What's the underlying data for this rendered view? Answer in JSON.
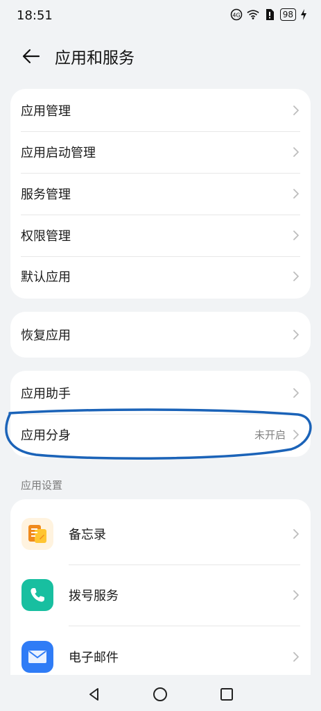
{
  "status_bar": {
    "time": "18:51",
    "battery": "98",
    "icons": [
      "volte-icon",
      "wifi-icon",
      "sim-icon",
      "battery-icon",
      "charging-icon"
    ]
  },
  "header": {
    "title": "应用和服务"
  },
  "group1": {
    "items": [
      {
        "label": "应用管理"
      },
      {
        "label": "应用启动管理"
      },
      {
        "label": "服务管理"
      },
      {
        "label": "权限管理"
      },
      {
        "label": "默认应用"
      }
    ]
  },
  "group2": {
    "items": [
      {
        "label": "恢复应用"
      }
    ]
  },
  "group3": {
    "items": [
      {
        "label": "应用助手",
        "value": ""
      },
      {
        "label": "应用分身",
        "value": "未开启"
      }
    ]
  },
  "app_settings": {
    "section_label": "应用设置",
    "items": [
      {
        "label": "备忘录",
        "icon": "memo-icon",
        "color": "#f5a623"
      },
      {
        "label": "拨号服务",
        "icon": "phone-icon",
        "color": "#1fc3a3"
      },
      {
        "label": "电子邮件",
        "icon": "email-icon",
        "color": "#2f7cf6"
      }
    ]
  },
  "annotation_color": "#1b63b8"
}
